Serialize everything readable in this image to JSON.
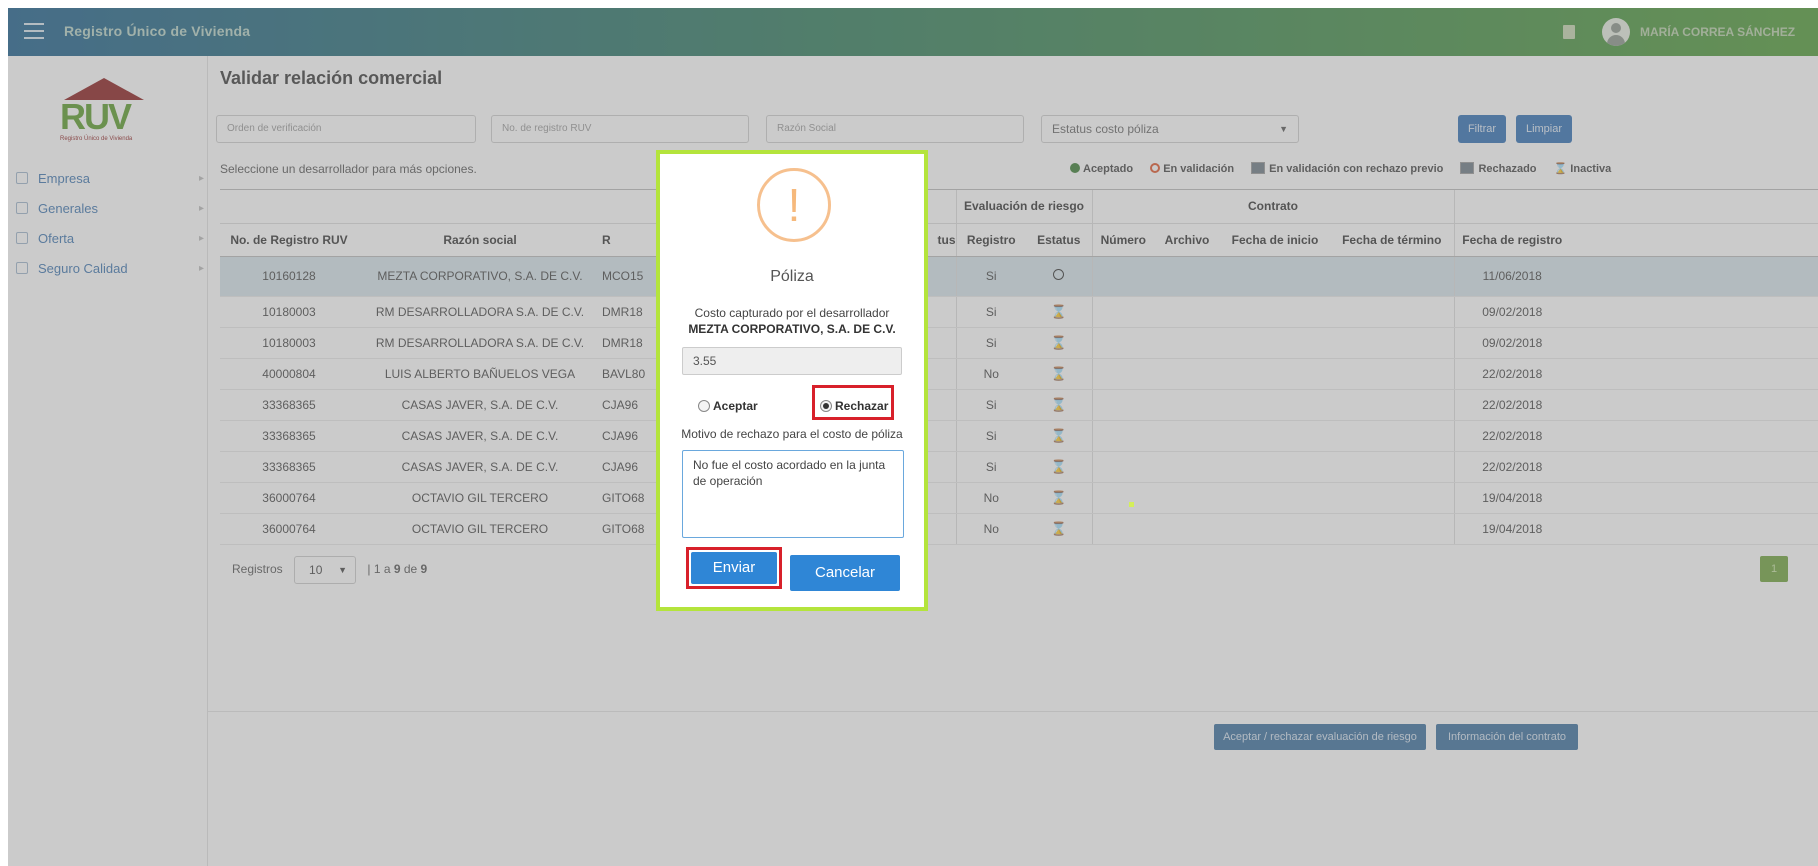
{
  "app": {
    "title": "Registro Único de Vivienda",
    "user": "MARÍA CORREA SÁNCHEZ"
  },
  "logo": {
    "text": "RUV",
    "subtitle": "Registro Único de Vivienda"
  },
  "sidebar": {
    "items": [
      {
        "label": "Empresa",
        "icon": "briefcase-icon"
      },
      {
        "label": "Generales",
        "icon": "grid-icon"
      },
      {
        "label": "Oferta",
        "icon": "house-icon"
      },
      {
        "label": "Seguro Calidad",
        "icon": "shield-icon"
      }
    ]
  },
  "page": {
    "title": "Validar relación comercial",
    "hint": "Seleccione un desarrollador para más opciones."
  },
  "filters": {
    "orden": "Orden de verificación",
    "registro": "No. de registro RUV",
    "razon": "Razón Social",
    "estatus": "Estatus costo póliza",
    "filtrar": "Filtrar",
    "limpiar": "Limpiar"
  },
  "legend": {
    "aceptado": "Aceptado",
    "en_validacion": "En validación",
    "rechazo_previo": "En validación con rechazo previo",
    "rechazado": "Rechazado",
    "inactiva": "Inactiva"
  },
  "table": {
    "groups": {
      "evaluacion": "Evaluación de riesgo",
      "contrato": "Contrato"
    },
    "columns": {
      "registro_ruv": "No. de Registro RUV",
      "razon": "Razón social",
      "r": "R",
      "estatus_partial": "tus",
      "ev_registro": "Registro",
      "ev_estatus": "Estatus",
      "numero": "Número",
      "archivo": "Archivo",
      "inicio": "Fecha de inicio",
      "termino": "Fecha de término",
      "fecha_registro": "Fecha de registro"
    },
    "rows": [
      {
        "ruv": "10160128",
        "razon": "MEZTA CORPORATIVO, S.A. DE C.V.",
        "rfc": "MCO15",
        "ev": "Si",
        "fecha": "11/06/2018"
      },
      {
        "ruv": "10180003",
        "razon": "RM DESARROLLADORA S.A. DE C.V.",
        "rfc": "DMR18",
        "ev": "Si",
        "fecha": "09/02/2018"
      },
      {
        "ruv": "10180003",
        "razon": "RM DESARROLLADORA S.A. DE C.V.",
        "rfc": "DMR18",
        "ev": "Si",
        "fecha": "09/02/2018"
      },
      {
        "ruv": "40000804",
        "razon": "LUIS ALBERTO BAÑUELOS VEGA",
        "rfc": "BAVL80",
        "ev": "No",
        "fecha": "22/02/2018"
      },
      {
        "ruv": "33368365",
        "razon": "CASAS JAVER, S.A. DE C.V.",
        "rfc": "CJA96",
        "ev": "Si",
        "fecha": "22/02/2018"
      },
      {
        "ruv": "33368365",
        "razon": "CASAS JAVER, S.A. DE C.V.",
        "rfc": "CJA96",
        "ev": "Si",
        "fecha": "22/02/2018"
      },
      {
        "ruv": "33368365",
        "razon": "CASAS JAVER, S.A. DE C.V.",
        "rfc": "CJA96",
        "ev": "Si",
        "fecha": "22/02/2018"
      },
      {
        "ruv": "36000764",
        "razon": "OCTAVIO GIL TERCERO",
        "rfc": "GITO68",
        "ev": "No",
        "fecha": "19/04/2018"
      },
      {
        "ruv": "36000764",
        "razon": "OCTAVIO GIL TERCERO",
        "rfc": "GITO68",
        "ev": "No",
        "fecha": "19/04/2018"
      }
    ]
  },
  "paging": {
    "label": "Registros",
    "size": "10",
    "range_prefix": "| 1 a ",
    "range_to": "9",
    "range_mid": " de ",
    "range_total": "9",
    "page": "1"
  },
  "footer": {
    "btn_riesgo": "Aceptar / rechazar evaluación de riesgo",
    "btn_contrato": "Información del contrato"
  },
  "modal": {
    "icon": "!",
    "title": "Póliza",
    "label": "Costo capturado por el desarrollador",
    "company": "MEZTA CORPORATIVO, S.A. DE C.V.",
    "cost": "3.55",
    "accept": "Aceptar",
    "reject": "Rechazar",
    "reason_label": "Motivo de rechazo para el costo de póliza",
    "reason": "No fue el costo acordado en la junta de operación",
    "send": "Enviar",
    "cancel": "Cancelar"
  }
}
